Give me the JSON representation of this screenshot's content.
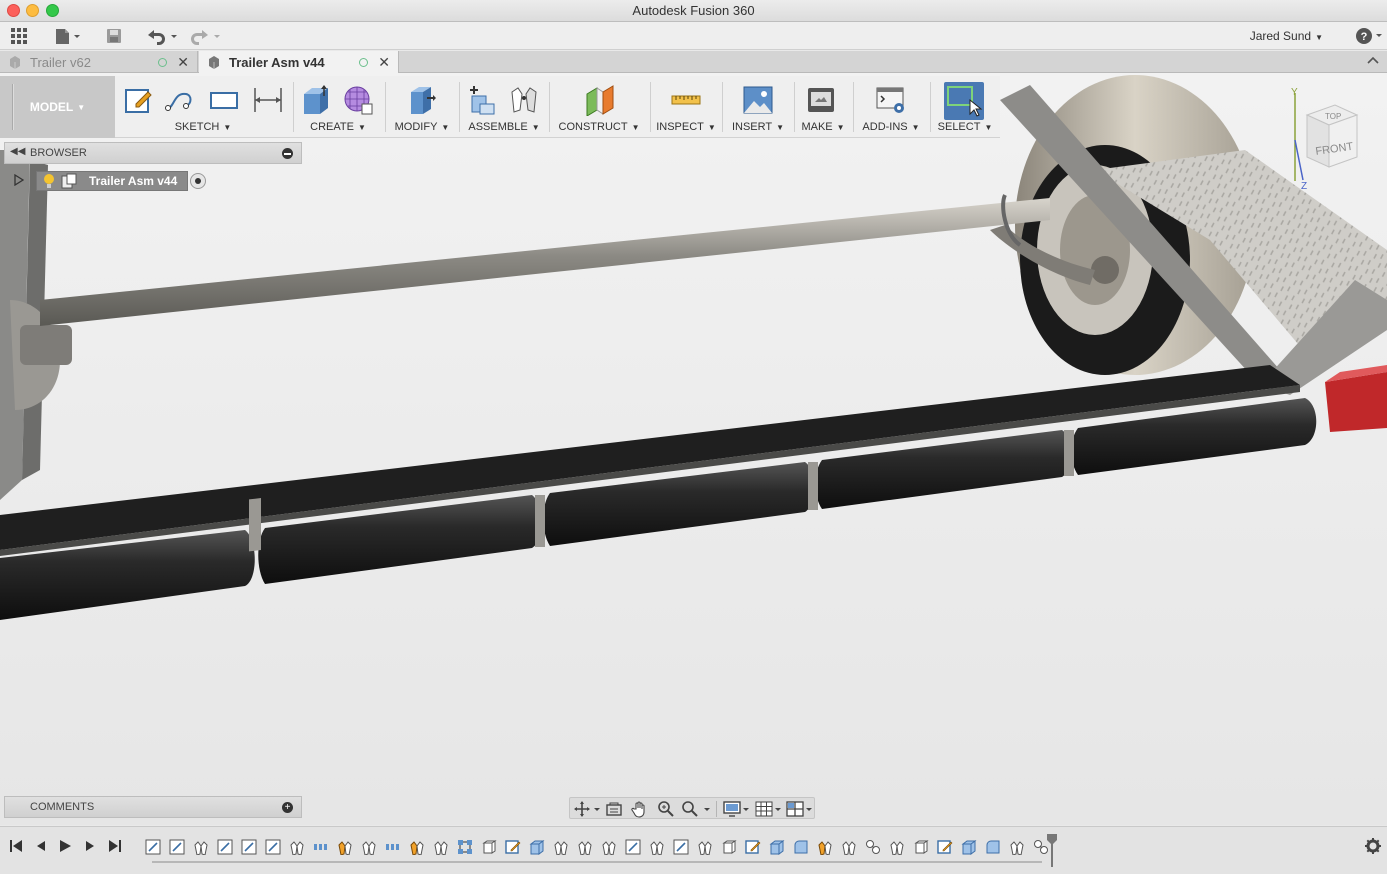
{
  "window": {
    "title": "Autodesk Fusion 360"
  },
  "appbar": {
    "user": "Jared Sund",
    "help_icon": "help-icon"
  },
  "tabs": [
    {
      "label": "Trailer v62",
      "active": false
    },
    {
      "label": "Trailer Asm v44",
      "active": true
    }
  ],
  "toolbar": {
    "workspace": "MODEL",
    "groups": [
      {
        "label": "SKETCH"
      },
      {
        "label": "CREATE"
      },
      {
        "label": "MODIFY"
      },
      {
        "label": "ASSEMBLE"
      },
      {
        "label": "CONSTRUCT"
      },
      {
        "label": "INSPECT"
      },
      {
        "label": "INSERT"
      },
      {
        "label": "MAKE"
      },
      {
        "label": "ADD-INS"
      },
      {
        "label": "SELECT"
      }
    ]
  },
  "browser": {
    "title": "BROWSER",
    "root": "Trailer Asm v44"
  },
  "comments": {
    "title": "COMMENTS"
  },
  "viewcube": {
    "top": "TOP",
    "front": "FRONT",
    "axis_y": "Y",
    "axis_z": "Z"
  },
  "colors": {
    "accent": "#4a79b3",
    "bunk": "#1f1f1f",
    "frame": "#7a7a7a",
    "tire": "#1a1a1a",
    "taillight": "#c0282a"
  }
}
